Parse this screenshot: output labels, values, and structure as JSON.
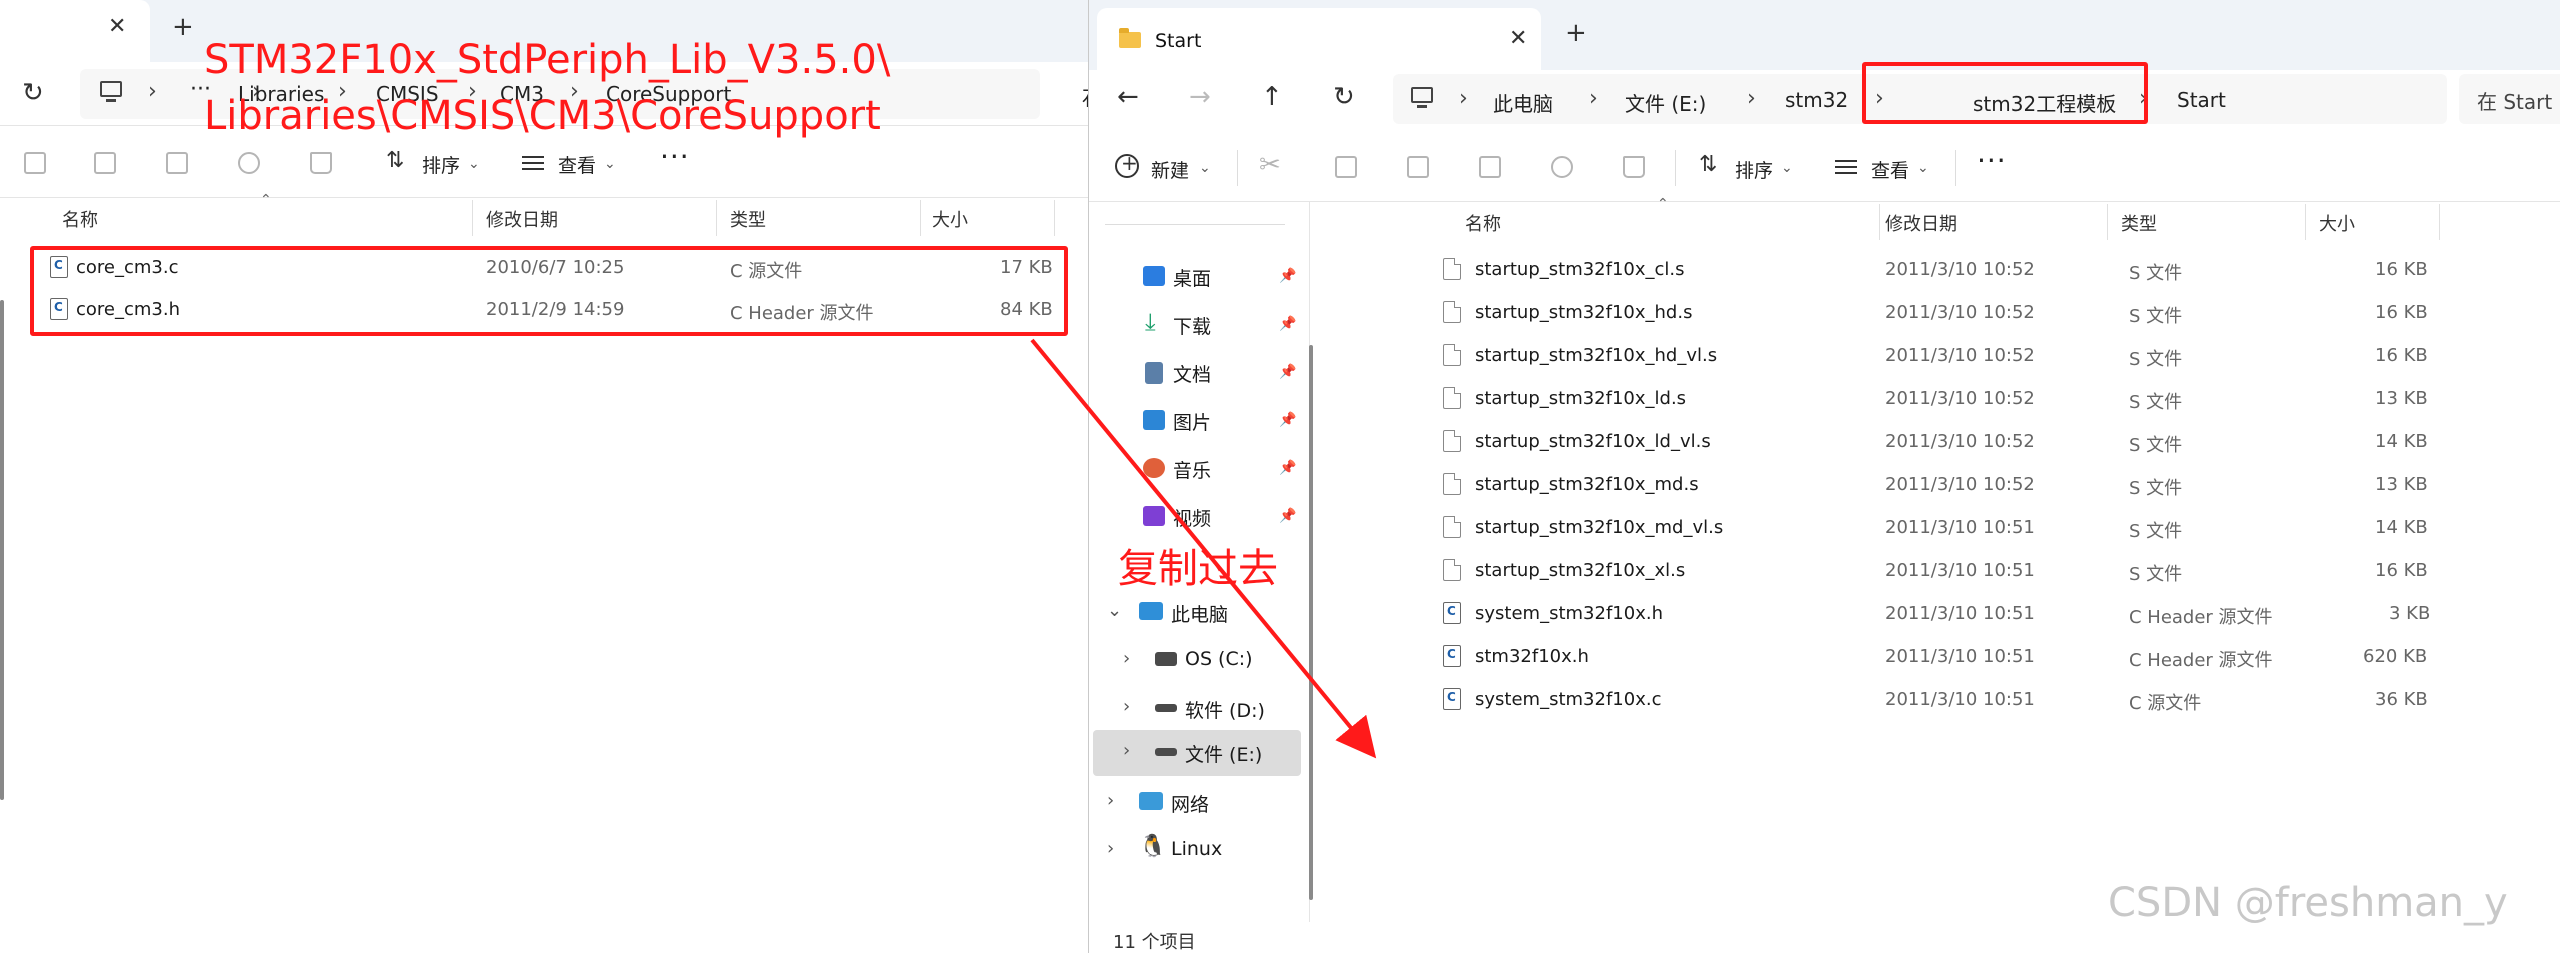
{
  "left_window": {
    "address": {
      "ellipsis": "···",
      "crumbs": [
        "Libraries",
        "CMSIS",
        "CM3",
        "CoreSupport"
      ],
      "overflow_char": "石"
    },
    "toolbar": {
      "sort_label": "排序",
      "view_label": "查看",
      "more_label": "···"
    },
    "columns": {
      "name": "名称",
      "date": "修改日期",
      "type": "类型",
      "size": "大小"
    },
    "files": [
      {
        "name": "core_cm3.c",
        "date": "2010/6/7 10:25",
        "type": "C 源文件",
        "size": "17 KB",
        "icon": "c-file-icon"
      },
      {
        "name": "core_cm3.h",
        "date": "2011/2/9 14:59",
        "type": "C Header 源文件",
        "size": "84 KB",
        "icon": "c-file-icon"
      }
    ]
  },
  "right_window": {
    "tab_title": "Start",
    "address": {
      "crumbs": [
        "此电脑",
        "文件 (E:)",
        "stm32",
        "stm32工程模板",
        "Start"
      ]
    },
    "search_placeholder": "在 Start 中搜索",
    "toolbar": {
      "new_label": "新建",
      "sort_label": "排序",
      "view_label": "查看",
      "more_label": "···"
    },
    "nav": {
      "quick_access": [
        {
          "label": "桌面",
          "icon": "desktop-icon",
          "color": "#2b7de0"
        },
        {
          "label": "下载",
          "icon": "download-icon",
          "color": "#1d9f6b"
        },
        {
          "label": "文档",
          "icon": "document-icon",
          "color": "#5b7fa8"
        },
        {
          "label": "图片",
          "icon": "pictures-icon",
          "color": "#2c86d6"
        },
        {
          "label": "音乐",
          "icon": "music-icon",
          "color": "#e0603a"
        },
        {
          "label": "视频",
          "icon": "video-icon",
          "color": "#7e3fd4"
        }
      ],
      "this_pc": "此电脑",
      "drives": [
        "OS (C:)",
        "软件 (D:)",
        "文件 (E:)"
      ],
      "network": "网络",
      "linux": "Linux"
    },
    "columns": {
      "name": "名称",
      "date": "修改日期",
      "type": "类型",
      "size": "大小"
    },
    "files": [
      {
        "name": "startup_stm32f10x_cl.s",
        "date": "2011/3/10 10:52",
        "type": "S 文件",
        "size": "16 KB",
        "kind": "s"
      },
      {
        "name": "startup_stm32f10x_hd.s",
        "date": "2011/3/10 10:52",
        "type": "S 文件",
        "size": "16 KB",
        "kind": "s"
      },
      {
        "name": "startup_stm32f10x_hd_vl.s",
        "date": "2011/3/10 10:52",
        "type": "S 文件",
        "size": "16 KB",
        "kind": "s"
      },
      {
        "name": "startup_stm32f10x_ld.s",
        "date": "2011/3/10 10:52",
        "type": "S 文件",
        "size": "13 KB",
        "kind": "s"
      },
      {
        "name": "startup_stm32f10x_ld_vl.s",
        "date": "2011/3/10 10:52",
        "type": "S 文件",
        "size": "14 KB",
        "kind": "s"
      },
      {
        "name": "startup_stm32f10x_md.s",
        "date": "2011/3/10 10:52",
        "type": "S 文件",
        "size": "13 KB",
        "kind": "s"
      },
      {
        "name": "startup_stm32f10x_md_vl.s",
        "date": "2011/3/10 10:51",
        "type": "S 文件",
        "size": "14 KB",
        "kind": "s"
      },
      {
        "name": "startup_stm32f10x_xl.s",
        "date": "2011/3/10 10:51",
        "type": "S 文件",
        "size": "16 KB",
        "kind": "s"
      },
      {
        "name": "system_stm32f10x.h",
        "date": "2011/3/10 10:51",
        "type": "C Header 源文件",
        "size": "3 KB",
        "kind": "c"
      },
      {
        "name": "stm32f10x.h",
        "date": "2011/3/10 10:51",
        "type": "C Header 源文件",
        "size": "620 KB",
        "kind": "c"
      },
      {
        "name": "system_stm32f10x.c",
        "date": "2011/3/10 10:51",
        "type": "C 源文件",
        "size": "36 KB",
        "kind": "c"
      }
    ],
    "status": "11 个项目"
  },
  "annotations": {
    "path_line1": "STM32F10x_StdPeriph_Lib_V3.5.0\\",
    "path_line2": "Libraries\\CMSIS\\CM3\\CoreSupport",
    "copy_label": "复制过去",
    "color": "#ff1a1a"
  },
  "watermark": "CSDN @freshman_y"
}
